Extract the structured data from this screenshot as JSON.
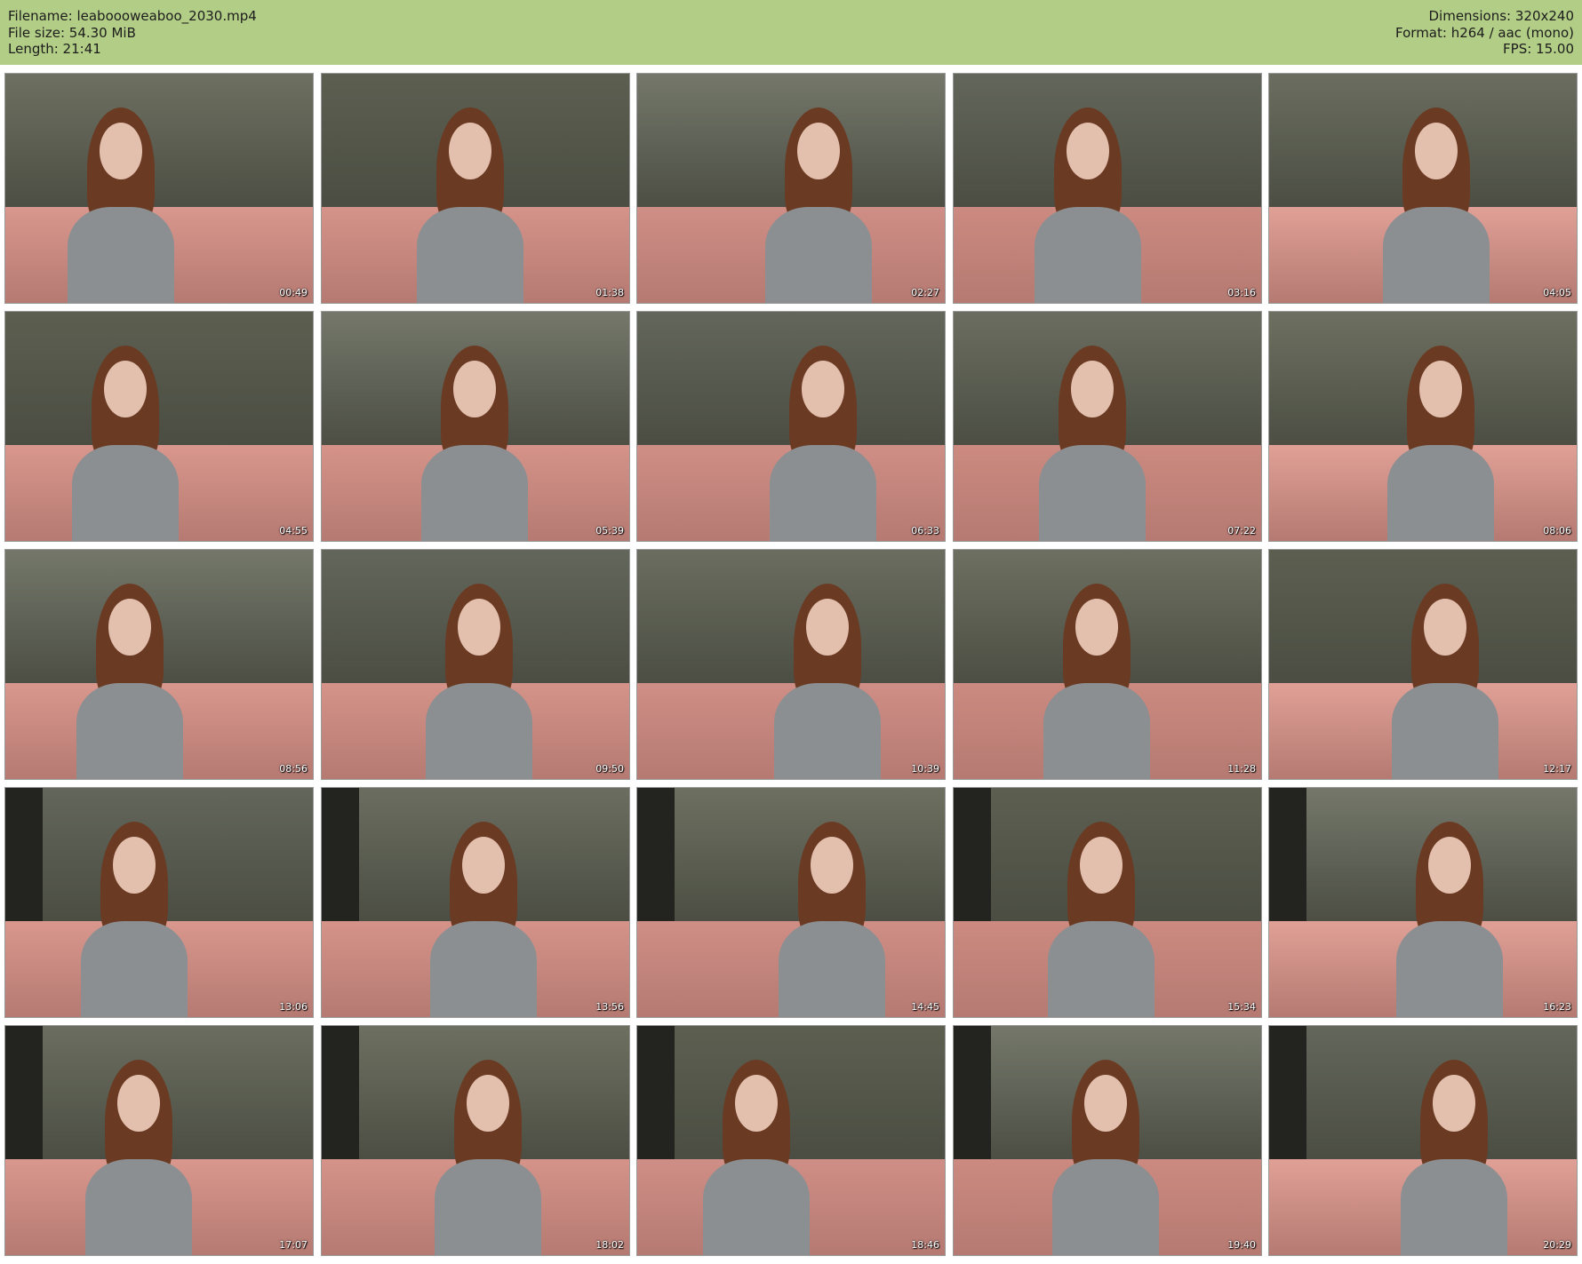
{
  "header": {
    "filename_line": "Filename: leaboooweaboo_2030.mp4",
    "filesize_line": "File size: 54.30 MiB",
    "length_line": "Length: 21:41",
    "dimensions_line": "Dimensions: 320x240",
    "format_line": "Format: h264 / aac (mono)",
    "fps_line": "FPS: 15.00",
    "background_color": "#b2cd86"
  },
  "thumbnails": [
    {
      "time": "00:49",
      "watermark": ""
    },
    {
      "time": "01:38",
      "watermark": ""
    },
    {
      "time": "02:27",
      "watermark": ""
    },
    {
      "time": "03:16",
      "watermark": ""
    },
    {
      "time": "04:05",
      "watermark": ""
    },
    {
      "time": "04:55",
      "watermark": ""
    },
    {
      "time": "05:39",
      "watermark": ""
    },
    {
      "time": "06:33",
      "watermark": ""
    },
    {
      "time": "07:22",
      "watermark": ""
    },
    {
      "time": "08:06",
      "watermark": ""
    },
    {
      "time": "08:56",
      "watermark": ""
    },
    {
      "time": "09:50",
      "watermark": ""
    },
    {
      "time": "10:39",
      "watermark": ""
    },
    {
      "time": "11:28",
      "watermark": ""
    },
    {
      "time": "12:17",
      "watermark": ""
    },
    {
      "time": "13:06",
      "watermark": ""
    },
    {
      "time": "13:56",
      "watermark": ""
    },
    {
      "time": "14:45",
      "watermark": ""
    },
    {
      "time": "15:34",
      "watermark": ""
    },
    {
      "time": "16:23",
      "watermark": ""
    },
    {
      "time": "17:07",
      "watermark": ""
    },
    {
      "time": "18:02",
      "watermark": ""
    },
    {
      "time": "18:46",
      "watermark": ""
    },
    {
      "time": "19:40",
      "watermark": ""
    },
    {
      "time": "20:29",
      "watermark": ""
    }
  ]
}
